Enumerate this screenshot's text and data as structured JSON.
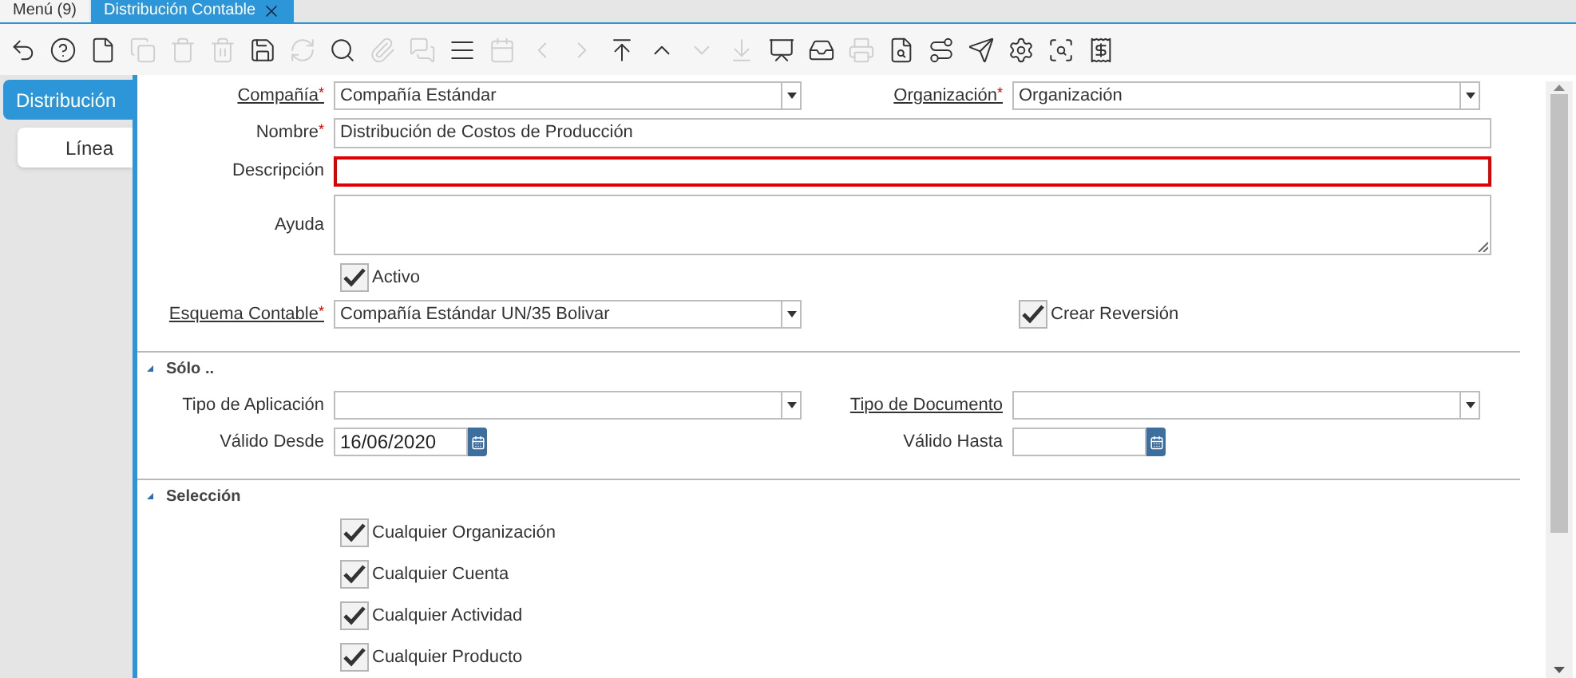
{
  "tabs": [
    {
      "label": "Menú (9)",
      "selected": false,
      "closable": false
    },
    {
      "label": "Distribución Contable",
      "selected": true,
      "closable": true
    }
  ],
  "toolbar": [
    {
      "disabled": false
    },
    {
      "disabled": false
    },
    {
      "disabled": false
    },
    {
      "disabled": true
    },
    {
      "disabled": true
    },
    {
      "disabled": true
    },
    {
      "disabled": false
    },
    {
      "disabled": true
    },
    {
      "disabled": false
    },
    {
      "disabled": true
    },
    {
      "disabled": true
    },
    {
      "disabled": false
    },
    {
      "disabled": true
    },
    {
      "disabled": true
    },
    {
      "disabled": true
    },
    {
      "disabled": false
    },
    {
      "disabled": false
    },
    {
      "disabled": true
    },
    {
      "disabled": true
    },
    {
      "disabled": false
    },
    {
      "disabled": false
    },
    {
      "disabled": true
    },
    {
      "disabled": false
    },
    {
      "disabled": false
    },
    {
      "disabled": false
    },
    {
      "disabled": false
    },
    {
      "disabled": false
    },
    {
      "disabled": false
    }
  ],
  "side_tabs": [
    {
      "label": "Distribución",
      "selected": true
    },
    {
      "label": "Línea",
      "selected": false
    }
  ],
  "form": {
    "rows": [
      [
        {
          "kind": "select",
          "label": "Compañía",
          "required_mark": "*",
          "link": true,
          "value": "Compañía Estándar",
          "wide": false,
          "invalid": false
        },
        {
          "kind": "select",
          "label": "Organización",
          "required_mark": "*",
          "link": true,
          "value": "Organización",
          "wide": false,
          "invalid": false
        }
      ],
      [
        {
          "kind": "text",
          "label": "Nombre",
          "required_mark": "*",
          "link": false,
          "value": "Distribución de Costos de Producción",
          "wide": true,
          "invalid": false
        }
      ],
      [
        {
          "kind": "text",
          "label": "Descripción",
          "link": false,
          "wide": true,
          "invalid": true
        }
      ],
      [
        {
          "kind": "textarea",
          "label": "Ayuda",
          "link": false,
          "wide": true,
          "invalid": false
        }
      ],
      [
        {
          "kind": "checkbox",
          "label": "Activo",
          "checked": true
        }
      ],
      [
        {
          "kind": "select",
          "label": "Esquema Contable",
          "required_mark": "*",
          "link": true,
          "value": "Compañía Estándar UN/35 Bolivar",
          "wide": false,
          "invalid": false
        },
        {
          "kind": "checkbox",
          "label": "Crear Reversión",
          "checked": true
        }
      ]
    ]
  },
  "sections": [
    {
      "title": "Sólo ..",
      "expanded": true,
      "rows": [
        [
          {
            "kind": "select",
            "label": "Tipo de Aplicación",
            "link": false,
            "wide": false,
            "invalid": false
          },
          {
            "kind": "select",
            "label": "Tipo de Documento",
            "link": true,
            "wide": false,
            "invalid": false
          }
        ],
        [
          {
            "kind": "date",
            "label": "Válido Desde",
            "link": false,
            "value": "16/06/2020",
            "wide": false,
            "invalid": false
          },
          {
            "kind": "date",
            "label": "Válido Hasta",
            "link": false,
            "wide": false,
            "invalid": false
          }
        ]
      ]
    },
    {
      "title": "Selección",
      "expanded": true,
      "rows": [
        [
          {
            "kind": "checkbox",
            "label": "Cualquier Organización",
            "checked": true
          }
        ],
        [
          {
            "kind": "checkbox",
            "label": "Cualquier Cuenta",
            "checked": true
          }
        ],
        [
          {
            "kind": "checkbox",
            "label": "Cualquier Actividad",
            "checked": true
          }
        ],
        [
          {
            "kind": "checkbox",
            "label": "Cualquier Producto",
            "checked": true
          }
        ]
      ]
    }
  ]
}
